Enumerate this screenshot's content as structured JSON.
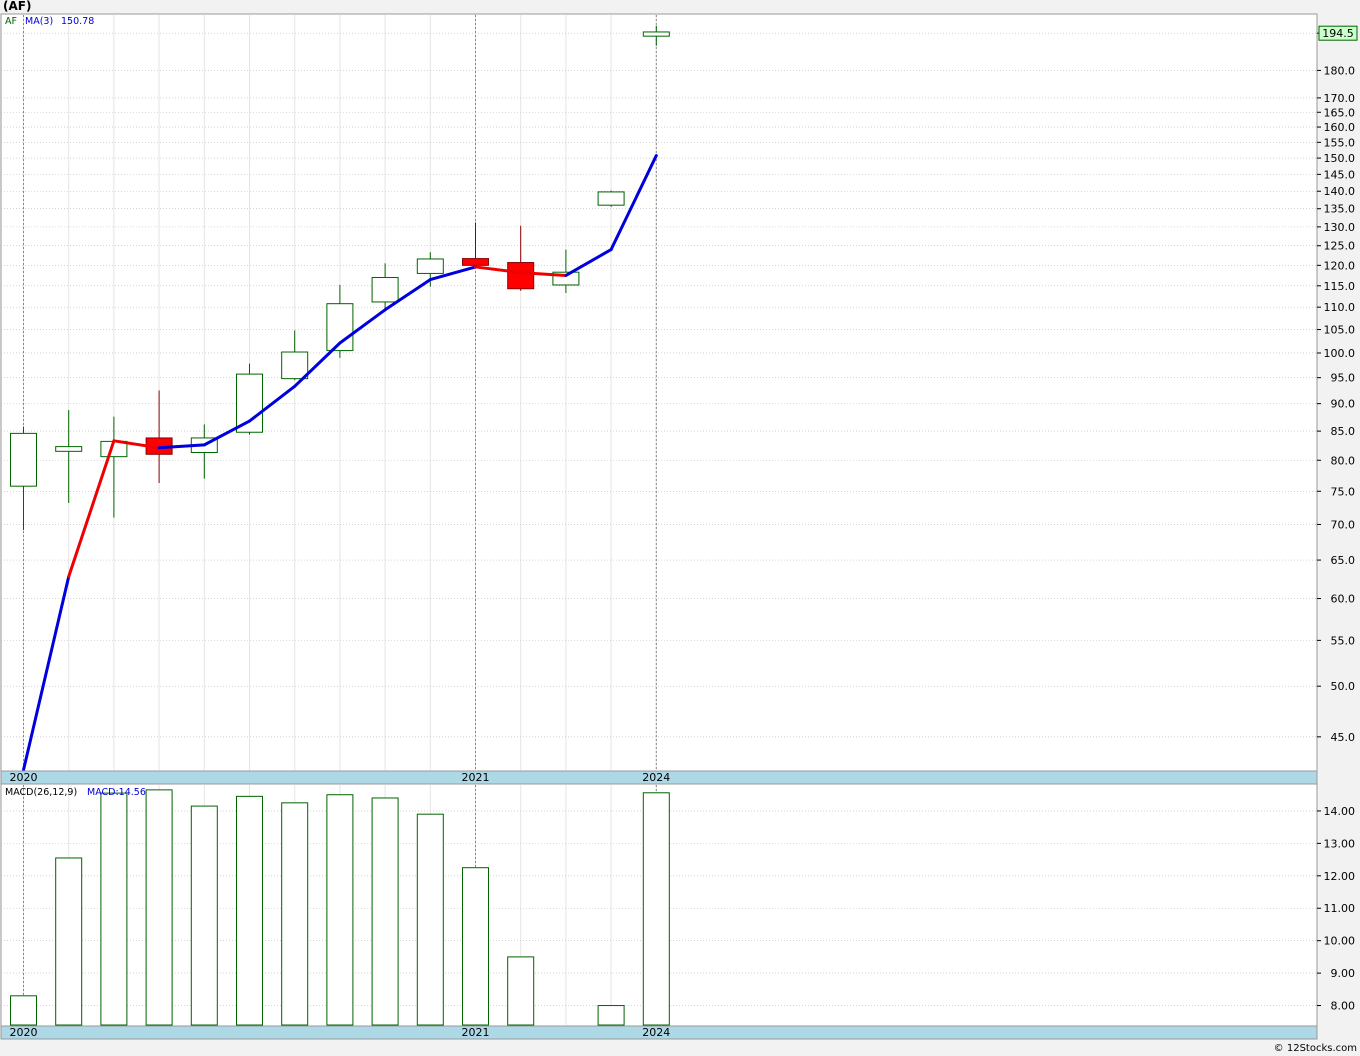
{
  "header": {
    "title": "(AF)"
  },
  "footer": {
    "copyright": "© 12Stocks.com"
  },
  "colors": {
    "background": "#ffffff",
    "page": "#f2f2f2",
    "grid": "#bbbbbb",
    "up_candle": "#006400",
    "down_candle": "#ff0000",
    "ma_up": "#0000dd",
    "ma_down": "#ee0000",
    "macd_bar": "#006400",
    "axis_band": "#add8e6",
    "last_price_bg": "#ccffcc"
  },
  "chart_data": [
    {
      "type": "candlestick",
      "legend": {
        "symbol": "AF",
        "ma_label": "MA(3)",
        "ma_value": "150.78"
      },
      "last_price_label": "194.5",
      "y_scale": "log",
      "ylim": [
        42,
        202
      ],
      "yticks": [
        45.0,
        50.0,
        55.0,
        60.0,
        65.0,
        70.0,
        75.0,
        80.0,
        85.0,
        90.0,
        95.0,
        100.0,
        105.0,
        110.0,
        115.0,
        120.0,
        125.0,
        130.0,
        135.0,
        140.0,
        145.0,
        150.0,
        155.0,
        160.0,
        165.0,
        170.0,
        180.0,
        194.5
      ],
      "x_labels": [
        {
          "index": 0,
          "label": "2020"
        },
        {
          "index": 10,
          "label": "2021"
        },
        {
          "index": 14,
          "label": "2024"
        }
      ],
      "candles": [
        {
          "open": 75.8,
          "high": 85.8,
          "low": 69.2,
          "close": 84.6
        },
        {
          "open": 81.5,
          "high": 88.8,
          "low": 73.2,
          "close": 82.3
        },
        {
          "open": 80.6,
          "high": 87.6,
          "low": 71.0,
          "close": 83.2
        },
        {
          "open": 83.8,
          "high": 92.5,
          "low": 76.3,
          "close": 81.0
        },
        {
          "open": 81.3,
          "high": 86.2,
          "low": 77.0,
          "close": 83.8
        },
        {
          "open": 84.8,
          "high": 97.8,
          "low": 84.4,
          "close": 95.7
        },
        {
          "open": 94.8,
          "high": 104.8,
          "low": 94.5,
          "close": 100.2
        },
        {
          "open": 100.5,
          "high": 115.2,
          "low": 99.0,
          "close": 110.8
        },
        {
          "open": 111.2,
          "high": 120.5,
          "low": 109.6,
          "close": 117.0
        },
        {
          "open": 118.0,
          "high": 123.3,
          "low": 114.8,
          "close": 121.6
        },
        {
          "open": 121.7,
          "high": 131.2,
          "low": 120.0,
          "close": 120.0
        },
        {
          "open": 120.7,
          "high": 130.3,
          "low": 113.8,
          "close": 114.3
        },
        {
          "open": 115.2,
          "high": 124.0,
          "low": 113.3,
          "close": 118.3
        },
        {
          "open": 136.0,
          "high": 140.2,
          "low": 135.5,
          "close": 139.8
        },
        {
          "open": 193.3,
          "high": 197.5,
          "low": 189.5,
          "close": 195.0
        }
      ],
      "ma": [
        42.0,
        62.8,
        83.3,
        82.1,
        82.6,
        86.8,
        93.3,
        102.1,
        109.4,
        116.5,
        119.6,
        118.2,
        117.5,
        124.0,
        150.78
      ],
      "ma_trend": [
        "up",
        "up",
        "down",
        "down",
        "up",
        "up",
        "up",
        "up",
        "up",
        "up",
        "up",
        "down",
        "down",
        "up",
        "up"
      ]
    },
    {
      "type": "bar",
      "legend": {
        "label": "MACD(26,12,9)",
        "value_label": "MACD:14.56"
      },
      "ylim": [
        7.4,
        14.8
      ],
      "yticks": [
        8.0,
        9.0,
        10.0,
        11.0,
        12.0,
        13.0,
        14.0
      ],
      "x_labels": [
        {
          "index": 0,
          "label": "2020"
        },
        {
          "index": 10,
          "label": "2021"
        },
        {
          "index": 14,
          "label": "2024"
        }
      ],
      "values": [
        8.3,
        12.55,
        14.55,
        14.65,
        14.15,
        14.45,
        14.25,
        14.5,
        14.4,
        13.9,
        12.25,
        9.5,
        null,
        8.0,
        14.56
      ]
    }
  ]
}
